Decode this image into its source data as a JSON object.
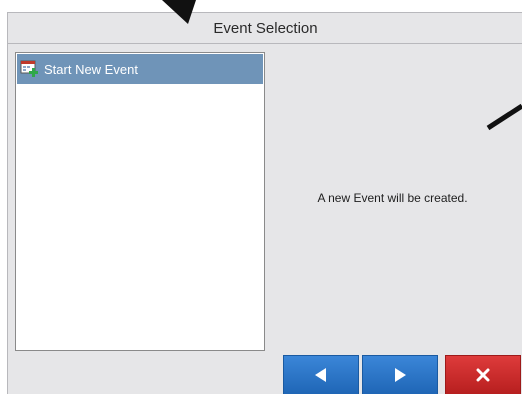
{
  "dialog": {
    "title": "Event Selection"
  },
  "event_list": {
    "items": [
      {
        "label": "Start New Event",
        "icon": "new-event-icon",
        "selected": true
      }
    ]
  },
  "message": "A new Event will be created.",
  "buttons": {
    "previous_icon": "left-triangle-icon",
    "next_icon": "right-triangle-icon",
    "cancel_icon": "close-x-icon"
  },
  "colors": {
    "selection": "#6f94b8",
    "nav_button": "#2a76c8",
    "cancel_button": "#cc2b2b",
    "dialog_background": "#e6e6e8"
  }
}
